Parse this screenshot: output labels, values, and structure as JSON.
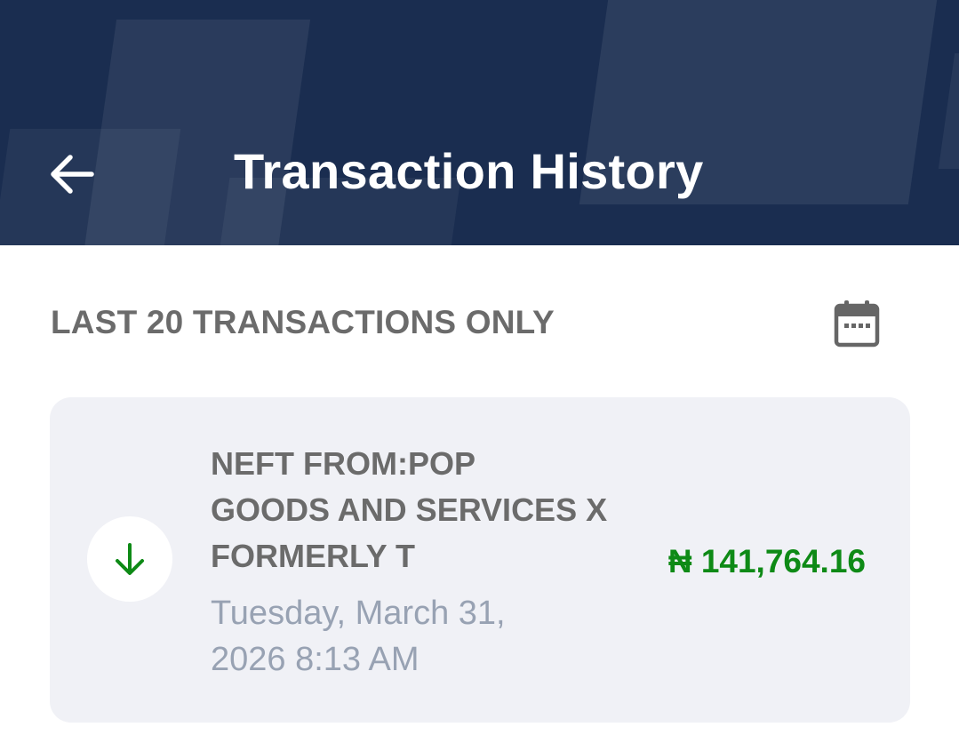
{
  "header": {
    "title": "Transaction History",
    "background_color": "#1a2d50",
    "back_icon": "arrow-left-icon"
  },
  "filter": {
    "label": "LAST 20 TRANSACTIONS ONLY",
    "calendar_icon": "calendar-icon"
  },
  "transactions": [
    {
      "direction": "credit",
      "direction_icon": "arrow-down-icon",
      "description_lines": [
        "NEFT FROM:POP",
        "GOODS AND SERVICES X",
        "FORMERLY T"
      ],
      "date_lines": [
        "Tuesday, March 31,",
        "2026 8:13 AM"
      ],
      "amount": "₦ 141,764.16",
      "amount_color": "#0e8a16"
    }
  ]
}
